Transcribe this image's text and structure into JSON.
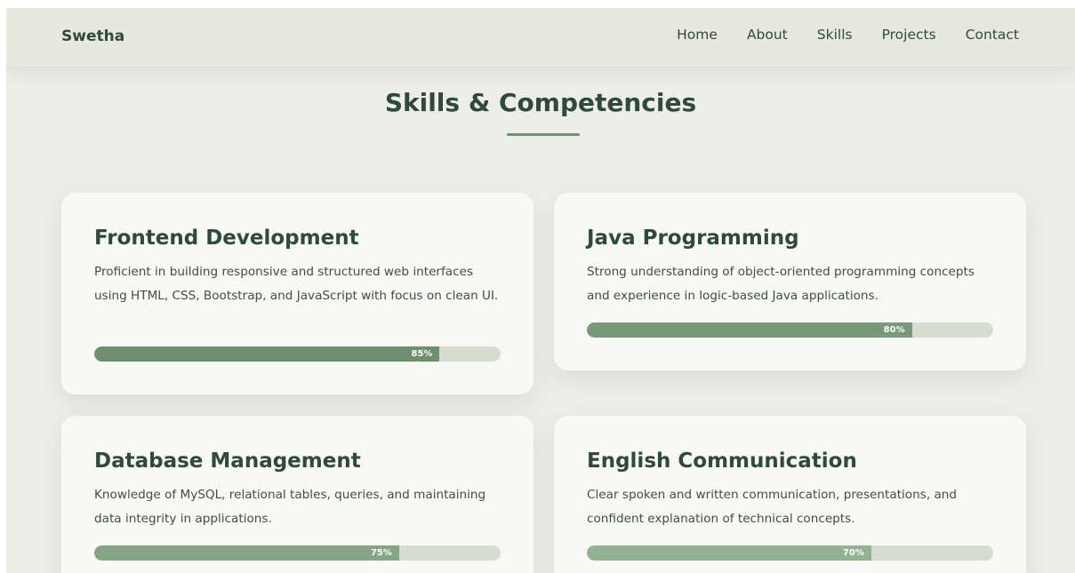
{
  "brand": "Swetha",
  "nav": [
    "Home",
    "About",
    "Skills",
    "Projects",
    "Contact"
  ],
  "section": {
    "title": "Skills & Competencies"
  },
  "skills": [
    {
      "title": "Frontend Development",
      "desc": "Proficient in building responsive and structured web interfaces using HTML, CSS, Bootstrap, and JavaScript with focus on clean UI.",
      "percent_label": "85%",
      "percent": 85,
      "color": "#6f8f6e"
    },
    {
      "title": "Java Programming",
      "desc": "Strong understanding of object-oriented programming concepts and experience in logic-based Java applications.",
      "percent_label": "80%",
      "percent": 80,
      "color": "#7a997a"
    },
    {
      "title": "Database Management",
      "desc": "Knowledge of MySQL, relational tables, queries, and maintaining data integrity in applications.",
      "percent_label": "75%",
      "percent": 75,
      "color": "#86a486"
    },
    {
      "title": "English Communication",
      "desc": "Clear spoken and written communication, presentations, and confident explanation of technical concepts.",
      "percent_label": "70%",
      "percent": 70,
      "color": "#93b193"
    }
  ],
  "colors": {
    "page_bg": "#edeee7",
    "nav_bg": "#e7e9df",
    "text": "#2f4a3a",
    "accent": "#6f9174",
    "card_bg": "#f8f8f4",
    "track": "#d6ddd0"
  }
}
